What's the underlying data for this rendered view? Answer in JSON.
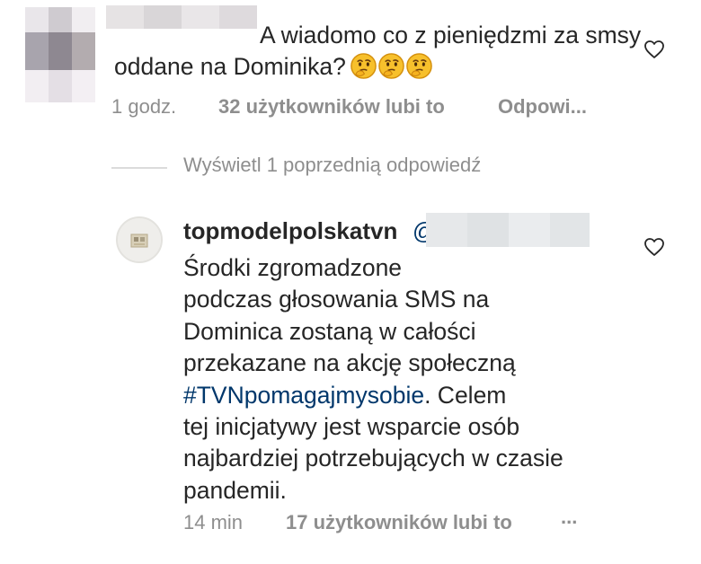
{
  "comment1": {
    "text": "A wiadomo co z pieniędzmi za smsy oddane na Dominika?",
    "emojis": [
      "thinking-face-emoji",
      "thinking-face-emoji",
      "thinking-face-emoji"
    ],
    "time": "1 godz.",
    "likes": "32 użytkowników lubi to",
    "reply_label": "Odpowi..."
  },
  "view_replies_label": "Wyświetl 1 poprzednią odpowiedź",
  "reply": {
    "username": "topmodelpolskatvn",
    "mention_prefix": "@",
    "text_lines": [
      "Środki zgromadzone",
      "podczas głosowania SMS na",
      "Dominica zostaną w całości",
      "przekazane na akcję społeczną"
    ],
    "hashtag": "#TVNpomagajmysobie",
    "text_after_hashtag": ". Celem",
    "text_lines_end": [
      "tej inicjatywy jest wsparcie osób",
      "najbardziej potrzebujących w czasie",
      "pandemii."
    ],
    "time": "14 min",
    "likes": "17 użytkowników lubi to",
    "more_label": "..."
  },
  "colors": {
    "text": "#262626",
    "meta": "#8e8e8e",
    "link": "#00376b",
    "divider": "#dbdbdb"
  }
}
